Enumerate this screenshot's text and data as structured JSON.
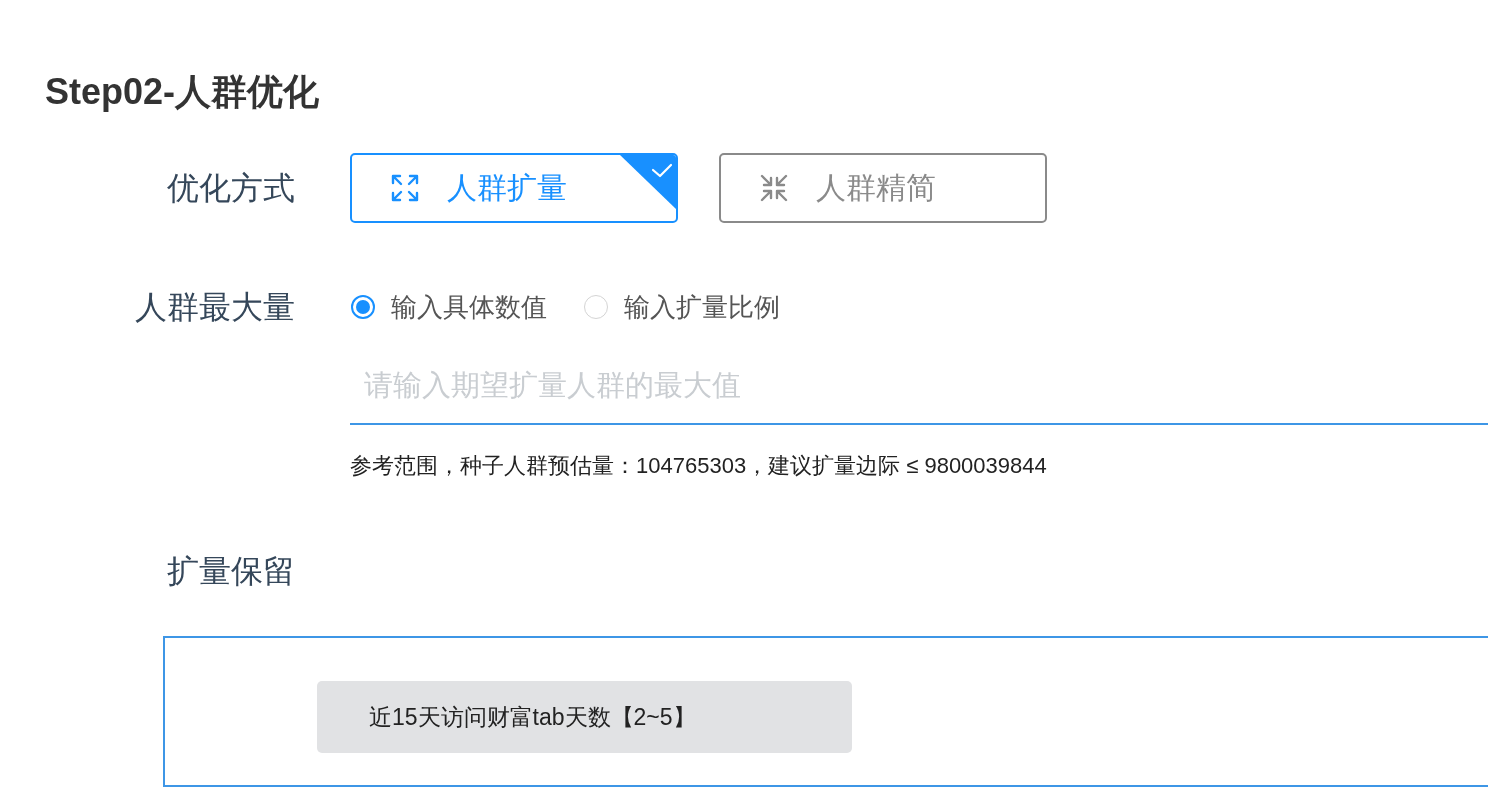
{
  "section_title": "Step02-人群优化",
  "optimization_method": {
    "label": "优化方式",
    "options": [
      {
        "label": "人群扩量",
        "kind": "expand",
        "selected": true
      },
      {
        "label": "人群精简",
        "kind": "shrink",
        "selected": false
      }
    ]
  },
  "max_audience": {
    "label": "人群最大量",
    "radios": [
      {
        "label": "输入具体数值",
        "selected": true
      },
      {
        "label": "输入扩量比例",
        "selected": false
      }
    ],
    "input": {
      "placeholder": "请输入期望扩量人群的最大值"
    },
    "hint": "参考范围，种子人群预估量：104765303，建议扩量边际 ≤ 9800039844"
  },
  "expansion_retention": {
    "label": "扩量保留",
    "tags": [
      "近15天访问财富tab天数【2~5】"
    ]
  }
}
